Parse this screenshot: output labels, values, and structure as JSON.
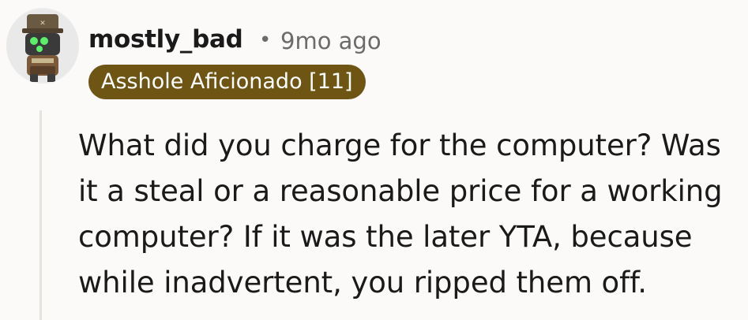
{
  "comment": {
    "author": "mostly_bad",
    "separator": "•",
    "time_ago": "9mo ago",
    "flair": "Asshole Aficionado [11]",
    "flair_color": "#6e5514",
    "avatar_icon": "robot-avatar-icon",
    "body_lines": [
      "What did you charge for the computer? Was",
      "it a steal or a reasonable price for a working",
      "computer? If it was the later YTA, because",
      "while inadvertent, you ripped them off."
    ]
  }
}
